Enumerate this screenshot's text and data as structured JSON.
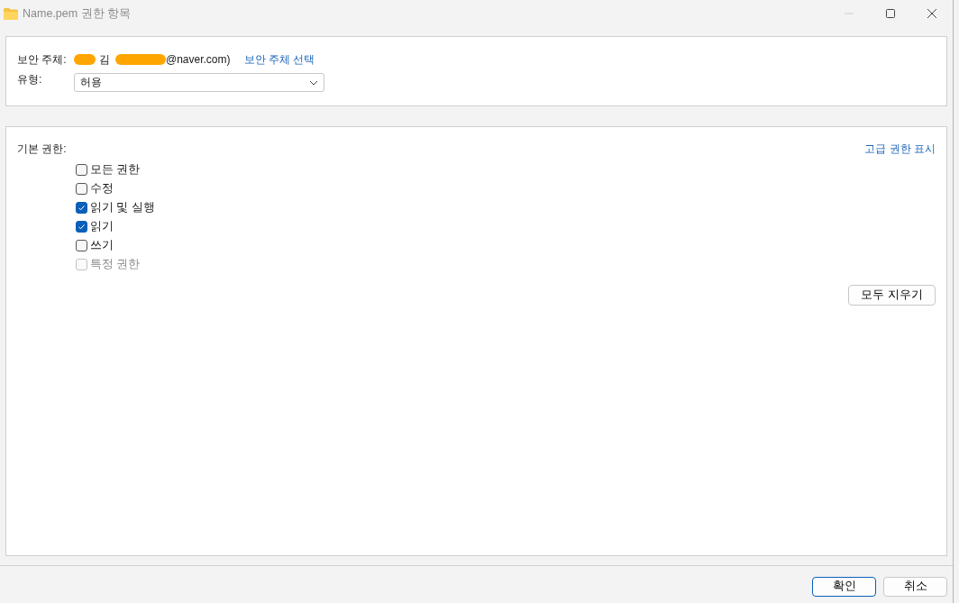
{
  "window": {
    "title": "Name.pem 권한 항목"
  },
  "principal": {
    "label": "보안 주체:",
    "visible_text": [
      "김",
      "@naver.com)"
    ],
    "link": "보안 주체 선택"
  },
  "type": {
    "label": "유형:",
    "value": "허용"
  },
  "permissions": {
    "label": "기본 권한:",
    "advanced_link": "고급 권한 표시",
    "items": [
      {
        "label": "모든 권한",
        "checked": false,
        "disabled": false
      },
      {
        "label": "수정",
        "checked": false,
        "disabled": false
      },
      {
        "label": "읽기 및 실행",
        "checked": true,
        "disabled": false
      },
      {
        "label": "읽기",
        "checked": true,
        "disabled": false
      },
      {
        "label": "쓰기",
        "checked": false,
        "disabled": false
      },
      {
        "label": "특정 권한",
        "checked": false,
        "disabled": true
      }
    ],
    "clear_button": "모두 지우기"
  },
  "buttons": [
    {
      "label": "확인",
      "default": true
    },
    {
      "label": "취소",
      "default": false
    }
  ]
}
